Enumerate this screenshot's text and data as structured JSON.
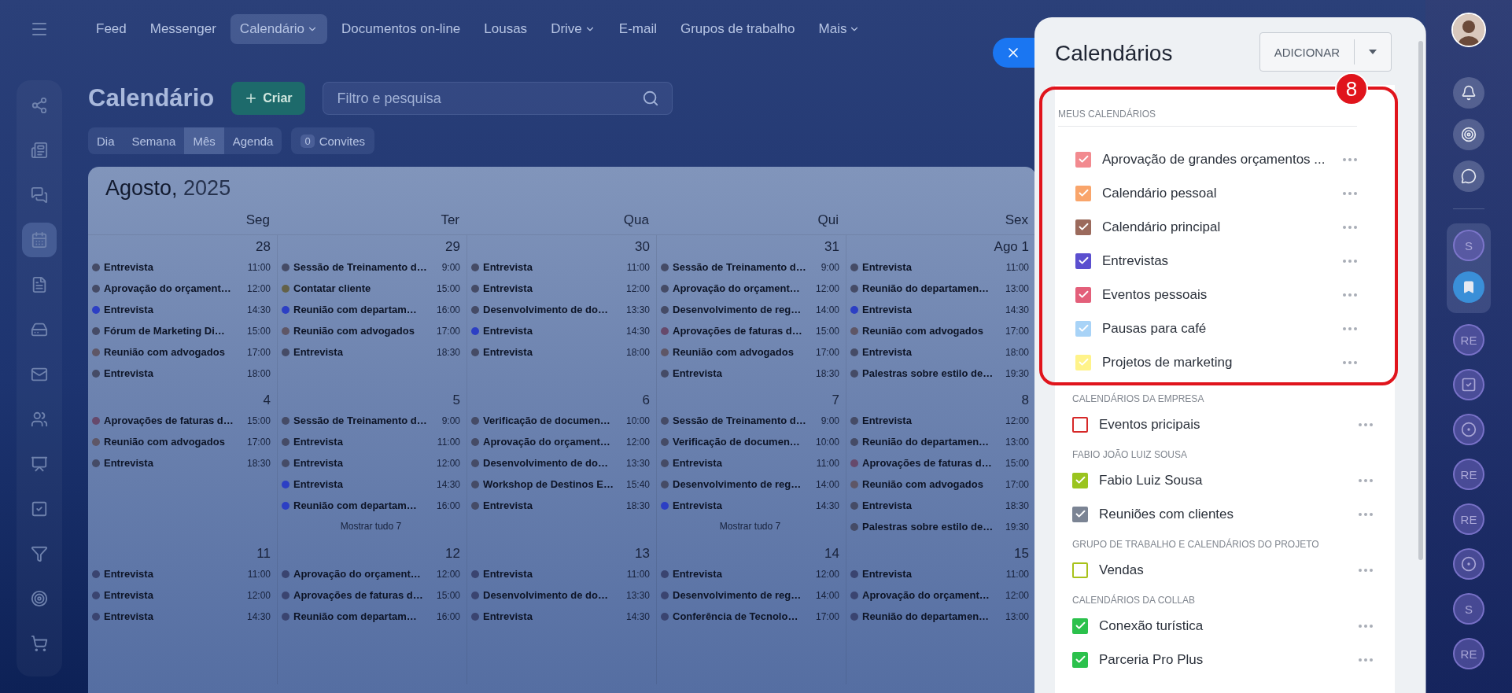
{
  "nav": {
    "items": [
      {
        "label": "Feed",
        "selected": false,
        "has_menu": false
      },
      {
        "label": "Messenger",
        "selected": false,
        "has_menu": false
      },
      {
        "label": "Calendário",
        "selected": true,
        "has_menu": true
      },
      {
        "label": "Documentos on-line",
        "selected": false,
        "has_menu": false
      },
      {
        "label": "Lousas",
        "selected": false,
        "has_menu": false
      },
      {
        "label": "Drive",
        "selected": false,
        "has_menu": true
      },
      {
        "label": "E-mail",
        "selected": false,
        "has_menu": false
      },
      {
        "label": "Grupos de trabalho",
        "selected": false,
        "has_menu": false
      },
      {
        "label": "Mais",
        "selected": false,
        "has_menu": true
      }
    ]
  },
  "sidebar": {
    "items": [
      {
        "kind": "orbit",
        "selected": false
      },
      {
        "kind": "news",
        "selected": false
      },
      {
        "kind": "chat",
        "selected": false
      },
      {
        "kind": "calendar",
        "selected": true
      },
      {
        "kind": "document",
        "selected": false
      },
      {
        "kind": "drive",
        "selected": false
      },
      {
        "kind": "mail",
        "selected": false
      },
      {
        "kind": "contacts",
        "selected": false
      },
      {
        "kind": "presentation",
        "selected": false
      },
      {
        "kind": "tasks",
        "selected": false
      },
      {
        "kind": "filter",
        "selected": false
      },
      {
        "kind": "target",
        "selected": false
      },
      {
        "kind": "cart",
        "selected": false
      }
    ]
  },
  "header": {
    "title": "Calendário",
    "create_button": "Criar",
    "search": {
      "placeholder": "Filtro e pesquisa"
    }
  },
  "views": [
    {
      "label": "Dia",
      "selected": false
    },
    {
      "label": "Semana",
      "selected": false
    },
    {
      "label": "Mês",
      "selected": true
    },
    {
      "label": "Agenda",
      "selected": false
    }
  ],
  "invites": {
    "count": "0",
    "label": "Convites"
  },
  "calendar": {
    "month": "Agosto,",
    "year": "2025",
    "weekdays": [
      "Seg",
      "Ter",
      "Qua",
      "Qui",
      "Sex"
    ],
    "weeks": [
      {
        "days": [
          {
            "date": "28",
            "events": [
              {
                "title": "Entrevista",
                "time": "11:00",
                "color": "#454b66"
              },
              {
                "title": "Aprovação do orçament…",
                "time": "12:00",
                "color": "#454b66"
              },
              {
                "title": "Entrevista",
                "time": "14:30",
                "color": "#2c3fc4"
              },
              {
                "title": "Fórum de Marketing Di…",
                "time": "15:00",
                "color": "#454b66"
              },
              {
                "title": "Reunião com advogados",
                "time": "17:00",
                "color": "#5e5666"
              },
              {
                "title": "Entrevista",
                "time": "18:00",
                "color": "#454b66"
              }
            ]
          },
          {
            "date": "29",
            "events": [
              {
                "title": "Sessão de Treinamento d…",
                "time": "9:00",
                "color": "#454b66"
              },
              {
                "title": "Contatar cliente",
                "time": "15:00",
                "color": "#636148"
              },
              {
                "title": "Reunião com departam…",
                "time": "16:00",
                "color": "#2c3fc4"
              },
              {
                "title": "Reunião com advogados",
                "time": "17:00",
                "color": "#5e5666"
              },
              {
                "title": "Entrevista",
                "time": "18:30",
                "color": "#454b66"
              }
            ]
          },
          {
            "date": "30",
            "events": [
              {
                "title": "Entrevista",
                "time": "11:00",
                "color": "#454b66"
              },
              {
                "title": "Entrevista",
                "time": "12:00",
                "color": "#454b66"
              },
              {
                "title": "Desenvolvimento de do…",
                "time": "13:30",
                "color": "#454b66"
              },
              {
                "title": "Entrevista",
                "time": "14:30",
                "color": "#2c3fc4"
              },
              {
                "title": "Entrevista",
                "time": "18:00",
                "color": "#454b66"
              }
            ]
          },
          {
            "date": "31",
            "events": [
              {
                "title": "Sessão de Treinamento d…",
                "time": "9:00",
                "color": "#454b66"
              },
              {
                "title": "Aprovação do orçament…",
                "time": "12:00",
                "color": "#454b66"
              },
              {
                "title": "Desenvolvimento de reg…",
                "time": "14:00",
                "color": "#454b66"
              },
              {
                "title": "Aprovações de faturas d…",
                "time": "15:00",
                "color": "#66496b"
              },
              {
                "title": "Reunião com advogados",
                "time": "17:00",
                "color": "#5e5666"
              },
              {
                "title": "Entrevista",
                "time": "18:30",
                "color": "#454b66"
              }
            ]
          },
          {
            "date": "Ago 1",
            "events": [
              {
                "title": "Entrevista",
                "time": "11:00",
                "color": "#454b66"
              },
              {
                "title": "Reunião do departamen…",
                "time": "13:00",
                "color": "#454b66"
              },
              {
                "title": "Entrevista",
                "time": "14:30",
                "color": "#2c3fc4"
              },
              {
                "title": "Reunião com advogados",
                "time": "17:00",
                "color": "#5e5666"
              },
              {
                "title": "Entrevista",
                "time": "18:00",
                "color": "#454b66"
              },
              {
                "title": "Palestras sobre estilo de…",
                "time": "19:30",
                "color": "#454b66"
              }
            ]
          }
        ]
      },
      {
        "days": [
          {
            "date": "4",
            "events": [
              {
                "title": "Aprovações de faturas d…",
                "time": "15:00",
                "color": "#66496b"
              },
              {
                "title": "Reunião com advogados",
                "time": "17:00",
                "color": "#5e5666"
              },
              {
                "title": "Entrevista",
                "time": "18:30",
                "color": "#454b66"
              }
            ]
          },
          {
            "date": "5",
            "events": [
              {
                "title": "Sessão de Treinamento d…",
                "time": "9:00",
                "color": "#454b66"
              },
              {
                "title": "Entrevista",
                "time": "11:00",
                "color": "#454b66"
              },
              {
                "title": "Entrevista",
                "time": "12:00",
                "color": "#454b66"
              },
              {
                "title": "Entrevista",
                "time": "14:30",
                "color": "#2c3fc4"
              },
              {
                "title": "Reunião com departam…",
                "time": "16:00",
                "color": "#2c3fc4"
              }
            ],
            "more": "Mostrar tudo 7"
          },
          {
            "date": "6",
            "events": [
              {
                "title": "Verificação de documen…",
                "time": "10:00",
                "color": "#454b66"
              },
              {
                "title": "Aprovação do orçament…",
                "time": "12:00",
                "color": "#454b66"
              },
              {
                "title": "Desenvolvimento de do…",
                "time": "13:30",
                "color": "#454b66"
              },
              {
                "title": "Workshop de Destinos E…",
                "time": "15:40",
                "color": "#454b66"
              },
              {
                "title": "Entrevista",
                "time": "18:30",
                "color": "#454b66"
              }
            ]
          },
          {
            "date": "7",
            "events": [
              {
                "title": "Sessão de Treinamento d…",
                "time": "9:00",
                "color": "#454b66"
              },
              {
                "title": "Verificação de documen…",
                "time": "10:00",
                "color": "#454b66"
              },
              {
                "title": "Entrevista",
                "time": "11:00",
                "color": "#454b66"
              },
              {
                "title": "Desenvolvimento de reg…",
                "time": "14:00",
                "color": "#454b66"
              },
              {
                "title": "Entrevista",
                "time": "14:30",
                "color": "#2c3fc4"
              }
            ],
            "more": "Mostrar tudo 7"
          },
          {
            "date": "8",
            "events": [
              {
                "title": "Entrevista",
                "time": "12:00",
                "color": "#454b66"
              },
              {
                "title": "Reunião do departamen…",
                "time": "13:00",
                "color": "#454b66"
              },
              {
                "title": "Aprovações de faturas d…",
                "time": "15:00",
                "color": "#66496b"
              },
              {
                "title": "Reunião com advogados",
                "time": "17:00",
                "color": "#5e5666"
              },
              {
                "title": "Entrevista",
                "time": "18:30",
                "color": "#454b66"
              },
              {
                "title": "Palestras sobre estilo de…",
                "time": "19:30",
                "color": "#454b66"
              }
            ]
          }
        ]
      },
      {
        "days": [
          {
            "date": "11",
            "events": [
              {
                "title": "Entrevista",
                "time": "11:00",
                "color": "#3a4470"
              },
              {
                "title": "Entrevista",
                "time": "12:00",
                "color": "#3a4470"
              },
              {
                "title": "Entrevista",
                "time": "14:30",
                "color": "#3a4470"
              }
            ]
          },
          {
            "date": "12",
            "events": [
              {
                "title": "Aprovação do orçament…",
                "time": "12:00",
                "color": "#3a4470"
              },
              {
                "title": "Aprovações de faturas d…",
                "time": "15:00",
                "color": "#3a4470"
              },
              {
                "title": "Reunião com departam…",
                "time": "16:00",
                "color": "#3a4470"
              }
            ]
          },
          {
            "date": "13",
            "events": [
              {
                "title": "Entrevista",
                "time": "11:00",
                "color": "#3a4470"
              },
              {
                "title": "Desenvolvimento de do…",
                "time": "13:30",
                "color": "#3a4470"
              },
              {
                "title": "Entrevista",
                "time": "14:30",
                "color": "#3a4470"
              }
            ]
          },
          {
            "date": "14",
            "events": [
              {
                "title": "Entrevista",
                "time": "12:00",
                "color": "#3a4470"
              },
              {
                "title": "Desenvolvimento de reg…",
                "time": "14:00",
                "color": "#3a4470"
              },
              {
                "title": "Conferência de Tecnolo…",
                "time": "17:00",
                "color": "#3a4470"
              }
            ]
          },
          {
            "date": "15",
            "events": [
              {
                "title": "Entrevista",
                "time": "11:00",
                "color": "#3a4470"
              },
              {
                "title": "Aprovação do orçament…",
                "time": "12:00",
                "color": "#3a4470"
              },
              {
                "title": "Reunião do departamen…",
                "time": "13:00",
                "color": "#3a4470"
              }
            ]
          }
        ]
      }
    ]
  },
  "panel": {
    "title": "Calendários",
    "add_button": "ADICIONAR",
    "callout": {
      "badge": "8"
    },
    "sections": [
      {
        "title": "MEUS CALENDÁRIOS",
        "highlighted": true,
        "items": [
          {
            "label": "Aprovação de grandes orçamentos ...",
            "checked": true,
            "color": "#f28a8f"
          },
          {
            "label": "Calendário pessoal",
            "checked": true,
            "color": "#f9a56b"
          },
          {
            "label": "Calendário principal",
            "checked": true,
            "color": "#9b6a5c"
          },
          {
            "label": "Entrevistas",
            "checked": true,
            "color": "#5b4fcf"
          },
          {
            "label": "Eventos pessoais",
            "checked": true,
            "color": "#e35f7a"
          },
          {
            "label": "Pausas para café",
            "checked": true,
            "color": "#a8d3f7"
          },
          {
            "label": "Projetos de marketing",
            "checked": true,
            "color": "#fff38a"
          }
        ]
      },
      {
        "title": "CALENDÁRIOS DA EMPRESA",
        "highlighted": false,
        "items": [
          {
            "label": "Eventos pricipais",
            "checked": false,
            "color": "#d62828"
          }
        ]
      },
      {
        "title": "FABIO JOÃO LUIZ SOUSA",
        "highlighted": false,
        "items": [
          {
            "label": "Fabio Luiz Sousa",
            "checked": true,
            "color": "#9ac41f"
          },
          {
            "label": "Reuniões com clientes",
            "checked": true,
            "color": "#7b8494"
          }
        ]
      },
      {
        "title": "GRUPO DE TRABALHO E CALENDÁRIOS DO PROJETO",
        "highlighted": false,
        "items": [
          {
            "label": "Vendas",
            "checked": false,
            "color": "#a8c21a"
          }
        ]
      },
      {
        "title": "CALENDÁRIOS DA COLLAB",
        "highlighted": false,
        "items": [
          {
            "label": "Conexão turística",
            "checked": true,
            "color": "#2bc14c"
          },
          {
            "label": "Parceria Pro Plus",
            "checked": true,
            "color": "#2bc14c"
          }
        ]
      }
    ]
  },
  "rightbar": {
    "items": [
      {
        "kind": "bell"
      },
      {
        "kind": "target"
      },
      {
        "kind": "chat"
      },
      {
        "kind": "divider"
      },
      {
        "kind": "letter",
        "text": "S",
        "grouped": true
      },
      {
        "kind": "bookmark",
        "grouped": true
      },
      {
        "kind": "letter",
        "text": "RE",
        "grouped": false
      },
      {
        "kind": "tasks",
        "grouped": false
      },
      {
        "kind": "orbit",
        "grouped": false
      },
      {
        "kind": "letter",
        "text": "RE",
        "grouped": false
      },
      {
        "kind": "letter",
        "text": "RE",
        "grouped": false
      },
      {
        "kind": "orbit",
        "grouped": false
      },
      {
        "kind": "letter",
        "text": "S",
        "grouped": false
      },
      {
        "kind": "letter",
        "text": "RE",
        "grouped": false
      }
    ]
  }
}
